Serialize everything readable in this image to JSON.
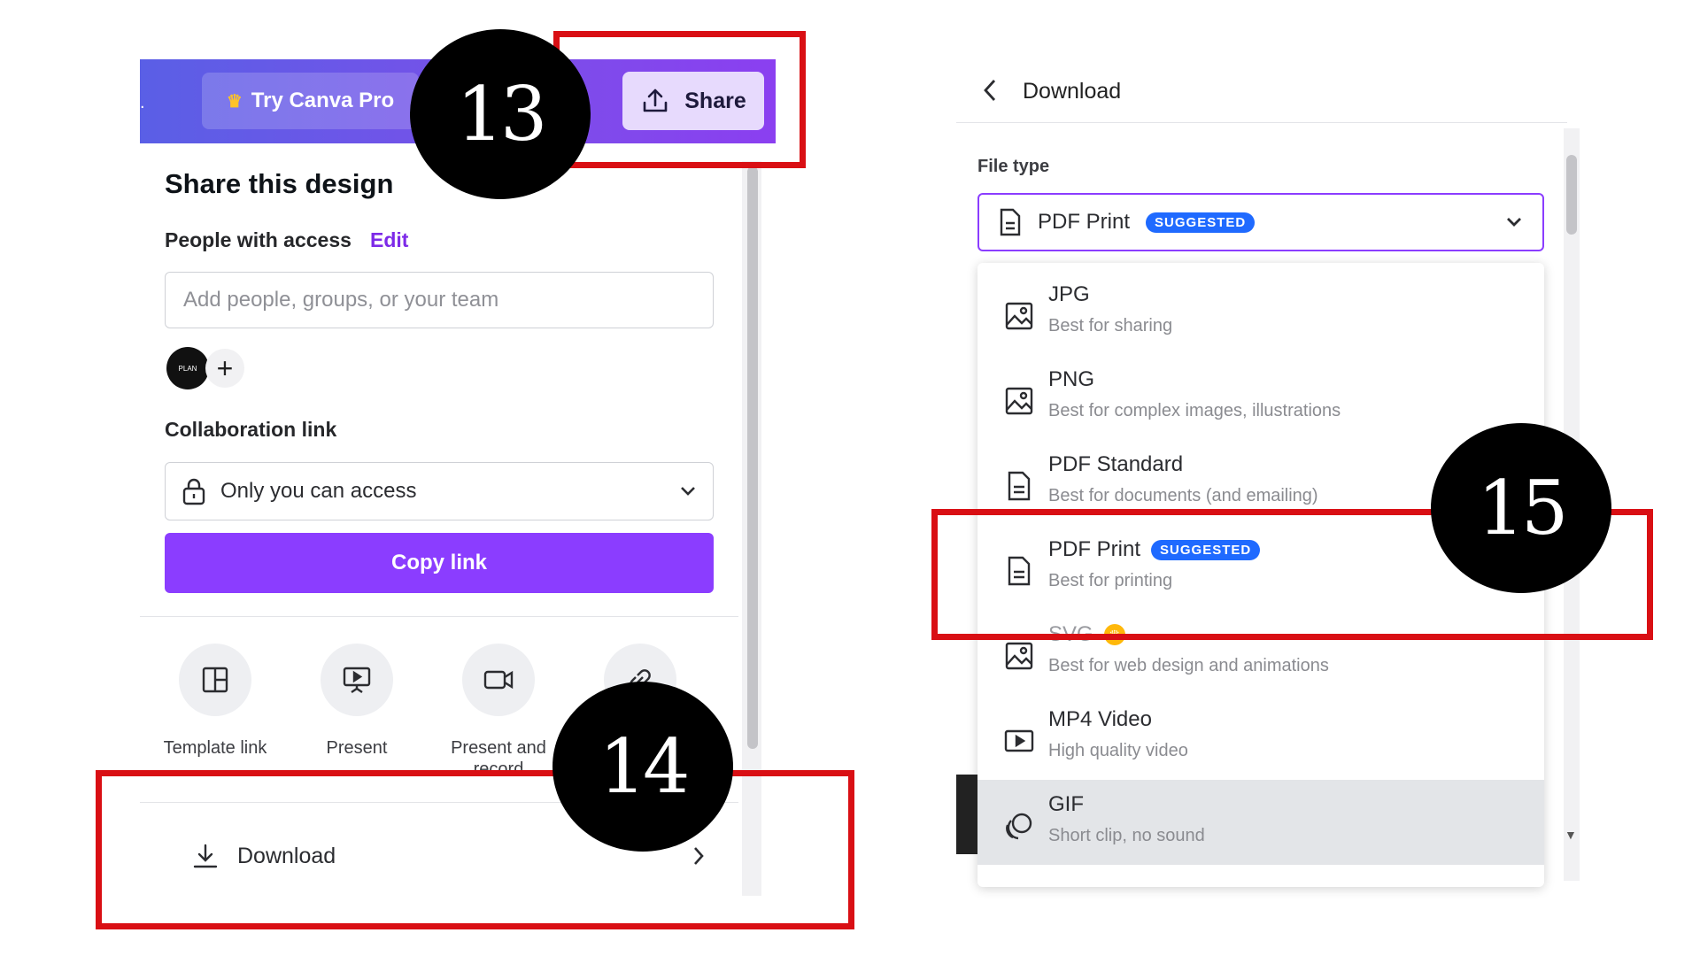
{
  "topbar": {
    "try_pro_label": "Try Canva Pro",
    "share_label": "Share"
  },
  "share_panel": {
    "title": "Share this design",
    "people_label": "People with access",
    "edit_label": "Edit",
    "add_people_placeholder": "Add people, groups, or your team",
    "collab_label": "Collaboration link",
    "collab_value": "Only you can access",
    "copy_link_label": "Copy link",
    "options": [
      {
        "label": "Template link",
        "icon": "template-icon"
      },
      {
        "label": "Present",
        "icon": "present-icon"
      },
      {
        "label": "Present and record",
        "icon": "video-camera-icon"
      },
      {
        "label": "",
        "icon": "link-icon"
      }
    ],
    "download_label": "Download"
  },
  "download_panel": {
    "title": "Download",
    "file_type_label": "File type",
    "selected_type": "PDF Print",
    "suggested_badge": "SUGGESTED",
    "file_types": [
      {
        "name": "JPG",
        "desc": "Best for sharing",
        "icon": "image-icon"
      },
      {
        "name": "PNG",
        "desc": "Best for complex images, illustrations",
        "icon": "image-icon"
      },
      {
        "name": "PDF Standard",
        "desc": "Best for documents (and emailing)",
        "icon": "document-icon"
      },
      {
        "name": "PDF Print",
        "desc": "Best for printing",
        "icon": "document-icon",
        "badge": "SUGGESTED"
      },
      {
        "name": "SVG",
        "desc": "Best for web design and animations",
        "icon": "image-icon",
        "pro": true
      },
      {
        "name": "MP4 Video",
        "desc": "High quality video",
        "icon": "video-icon"
      },
      {
        "name": "GIF",
        "desc": "Short clip, no sound",
        "icon": "gif-icon"
      }
    ]
  },
  "annotations": {
    "step_13": "13",
    "step_14": "14",
    "step_15": "15"
  },
  "colors": {
    "brand_purple": "#8b3dff",
    "badge_blue": "#1f6aff",
    "annotation_red": "#d90f14"
  }
}
